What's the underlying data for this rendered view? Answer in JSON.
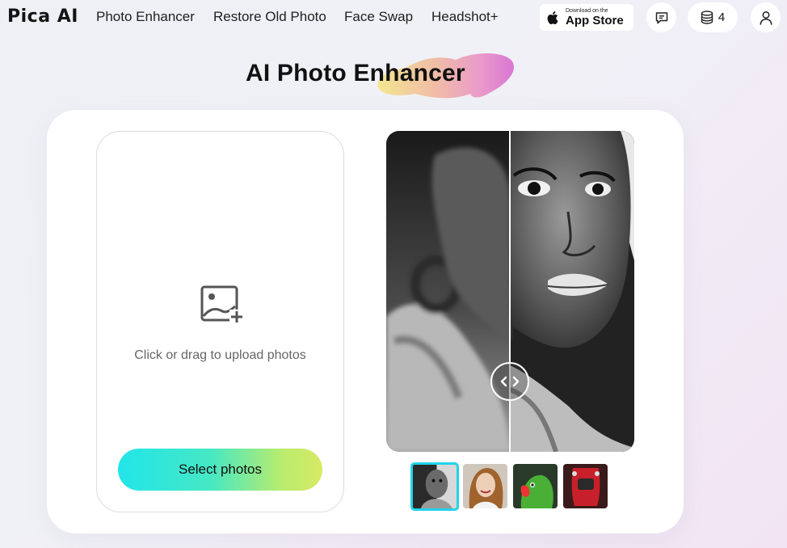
{
  "header": {
    "logo": "Pica AI",
    "nav_links": [
      "Photo Enhancer",
      "Restore Old Photo",
      "Face Swap",
      "Headshot+"
    ],
    "app_store": {
      "small": "Download on the",
      "big": "App Store"
    },
    "credits": "4"
  },
  "main": {
    "title": "AI Photo Enhancer",
    "upload_hint": "Click or drag to upload photos",
    "select_button": "Select photos"
  },
  "colors": {
    "button_gradient_start": "#22e5ea",
    "button_gradient_end": "#d8ea64",
    "thumb_active_border": "#22d3ea"
  },
  "icons": [
    "apple-icon",
    "feedback-icon",
    "credits-stack-icon",
    "user-icon",
    "image-add-icon",
    "compare-slider-icon"
  ],
  "preview": {
    "thumbnails": [
      "portrait-woman-bw",
      "portrait-woman-smiling",
      "parrot",
      "red-car"
    ],
    "active_thumbnail": 0
  }
}
